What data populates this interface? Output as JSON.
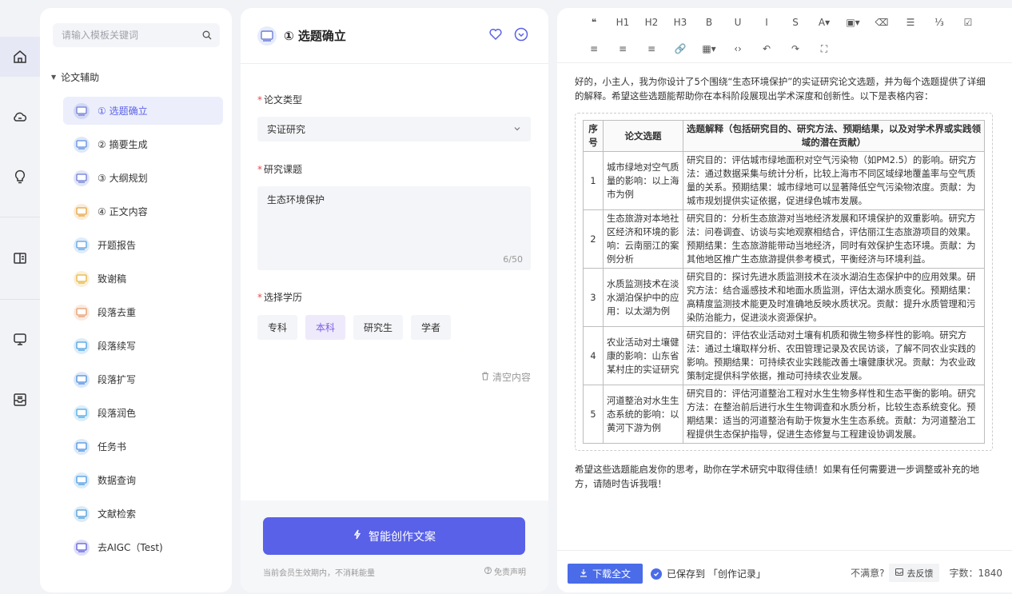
{
  "search": {
    "placeholder": "请输入模板关键词"
  },
  "template_group": {
    "label": "论文辅助"
  },
  "templates": [
    {
      "label": "① 选题确立",
      "active": true,
      "color": "#6f7dd6"
    },
    {
      "label": "② 摘要生成",
      "color": "#5a8de0"
    },
    {
      "label": "③ 大纲规划",
      "color": "#6a7bd8"
    },
    {
      "label": "④ 正文内容",
      "color": "#e8a23a"
    },
    {
      "label": "开题报告",
      "color": "#5aa0e8"
    },
    {
      "label": "致谢稿",
      "color": "#e8b23a"
    },
    {
      "label": "段落去重",
      "color": "#e89a6a"
    },
    {
      "label": "段落续写",
      "color": "#4aa0e0"
    },
    {
      "label": "段落扩写",
      "color": "#4a8ce0"
    },
    {
      "label": "段落润色",
      "color": "#4aa8e8"
    },
    {
      "label": "任务书",
      "color": "#4a90e2"
    },
    {
      "label": "数据查询",
      "color": "#4a9ae0"
    },
    {
      "label": "文献检索",
      "color": "#4a9ad8"
    },
    {
      "label": "去AIGC（Test)",
      "color": "#5a5ae0"
    }
  ],
  "form": {
    "title": "① 选题确立",
    "type_label": "论文类型",
    "type_value": "实证研究",
    "topic_label": "研究课题",
    "topic_value": "生态环境保护",
    "topic_count": "6/50",
    "degree_label": "选择学历",
    "degrees": [
      "专科",
      "本科",
      "研究生",
      "学者"
    ],
    "degree_selected": "本科",
    "clear_label": "清空内容",
    "generate_label": "智能创作文案",
    "member_note": "当前会员生效期内，不消耗能量",
    "disclaimer": "免责声明"
  },
  "toolbar": {
    "row1": [
      "❝",
      "H1",
      "H2",
      "H3",
      "B",
      "U",
      "I",
      "S",
      "A▾",
      "▣▾",
      "⌫",
      "☰",
      "⅓",
      "☑"
    ],
    "row2": [
      "≡",
      "≡",
      "≡",
      "🔗",
      "▦▾",
      "‹›",
      "↶",
      "↷",
      "⛶"
    ]
  },
  "doc": {
    "intro": "好的，小主人，我为你设计了5个围绕“生态环境保护”的实证研究论文选题，并为每个选题提供了详细的解释。希望这些选题能帮助你在本科阶段展现出学术深度和创新性。以下是表格内容：",
    "headers": [
      "序号",
      "论文选题",
      "选题解释（包括研究目的、研究方法、预期结果，以及对学术界或实践领域的潜在贡献）"
    ],
    "rows": [
      {
        "no": "1",
        "title": "城市绿地对空气质量的影响：以上海市为例",
        "desc": "研究目的：评估城市绿地面积对空气污染物（如PM2.5）的影响。研究方法：通过数据采集与统计分析，比较上海市不同区域绿地覆盖率与空气质量的关系。预期结果：城市绿地可以显著降低空气污染物浓度。贡献：为城市规划提供实证依据，促进绿色城市发展。"
      },
      {
        "no": "2",
        "title": "生态旅游对本地社区经济和环境的影响：云南丽江的案例分析",
        "desc": "研究目的：分析生态旅游对当地经济发展和环境保护的双重影响。研究方法：问卷调查、访谈与实地观察相结合，评估丽江生态旅游项目的效果。预期结果：生态旅游能带动当地经济，同时有效保护生态环境。贡献：为其他地区推广生态旅游提供参考模式，平衡经济与环境利益。"
      },
      {
        "no": "3",
        "title": "水质监测技术在淡水湖泊保护中的应用：以太湖为例",
        "desc": "研究目的：探讨先进水质监测技术在淡水湖泊生态保护中的应用效果。研究方法：结合遥感技术和地面水质监测，评估太湖水质变化。预期结果：高精度监测技术能更及时准确地反映水质状况。贡献：提升水质管理和污染防治能力，促进淡水资源保护。"
      },
      {
        "no": "4",
        "title": "农业活动对土壤健康的影响：山东省某村庄的实证研究",
        "desc": "研究目的：评估农业活动对土壤有机质和微生物多样性的影响。研究方法：通过土壤取样分析、农田管理记录及农民访谈，了解不同农业实践的影响。预期结果：可持续农业实践能改善土壤健康状况。贡献：为农业政策制定提供科学依据，推动可持续农业发展。"
      },
      {
        "no": "5",
        "title": "河道整治对水生生态系统的影响：以黄河下游为例",
        "desc": "研究目的：评估河道整治工程对水生生物多样性和生态平衡的影响。研究方法：在整治前后进行水生生物调查和水质分析，比较生态系统变化。预期结果：适当的河道整治有助于恢复水生生态系统。贡献：为河道整治工程提供生态保护指导，促进生态修复与工程建设协调发展。"
      }
    ],
    "outro": "希望这些选题能启发你的思考，助你在学术研究中取得佳绩！如果有任何需要进一步调整或补充的地方，请随时告诉我哦！"
  },
  "status": {
    "download_label": "下载全文",
    "saved_text": "已保存到 「创作记录」",
    "unsatisfied": "不满意?",
    "feedback_label": "去反馈",
    "word_count": "字数：1840"
  },
  "colors": {
    "accent": "#5961e8",
    "download": "#4a6ce8",
    "required": "#e84a4a"
  }
}
